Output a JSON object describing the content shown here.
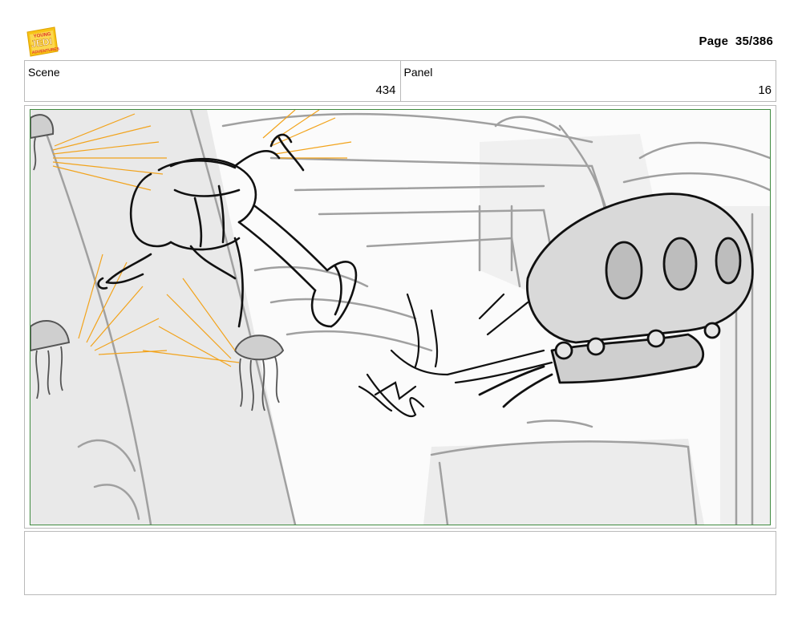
{
  "header": {
    "logo_icon": "young-jedi-adventures-logo",
    "logo_text": [
      "YOUNG",
      "JEDI",
      "ADVENTURES"
    ],
    "page_label": "Page",
    "page_value": "35/386"
  },
  "info": {
    "scene_label": "Scene",
    "scene_value": "434",
    "panel_label": "Panel",
    "panel_value": "16"
  },
  "notes": {
    "text": ""
  },
  "colors": {
    "border": "#b9b9b9",
    "panel_frame": "#3f8a3f",
    "sketch_line": "#111111",
    "rough_line": "#9a9a9a",
    "highlight_lines": "#f2a31b",
    "logo_yellow": "#f7c316"
  }
}
